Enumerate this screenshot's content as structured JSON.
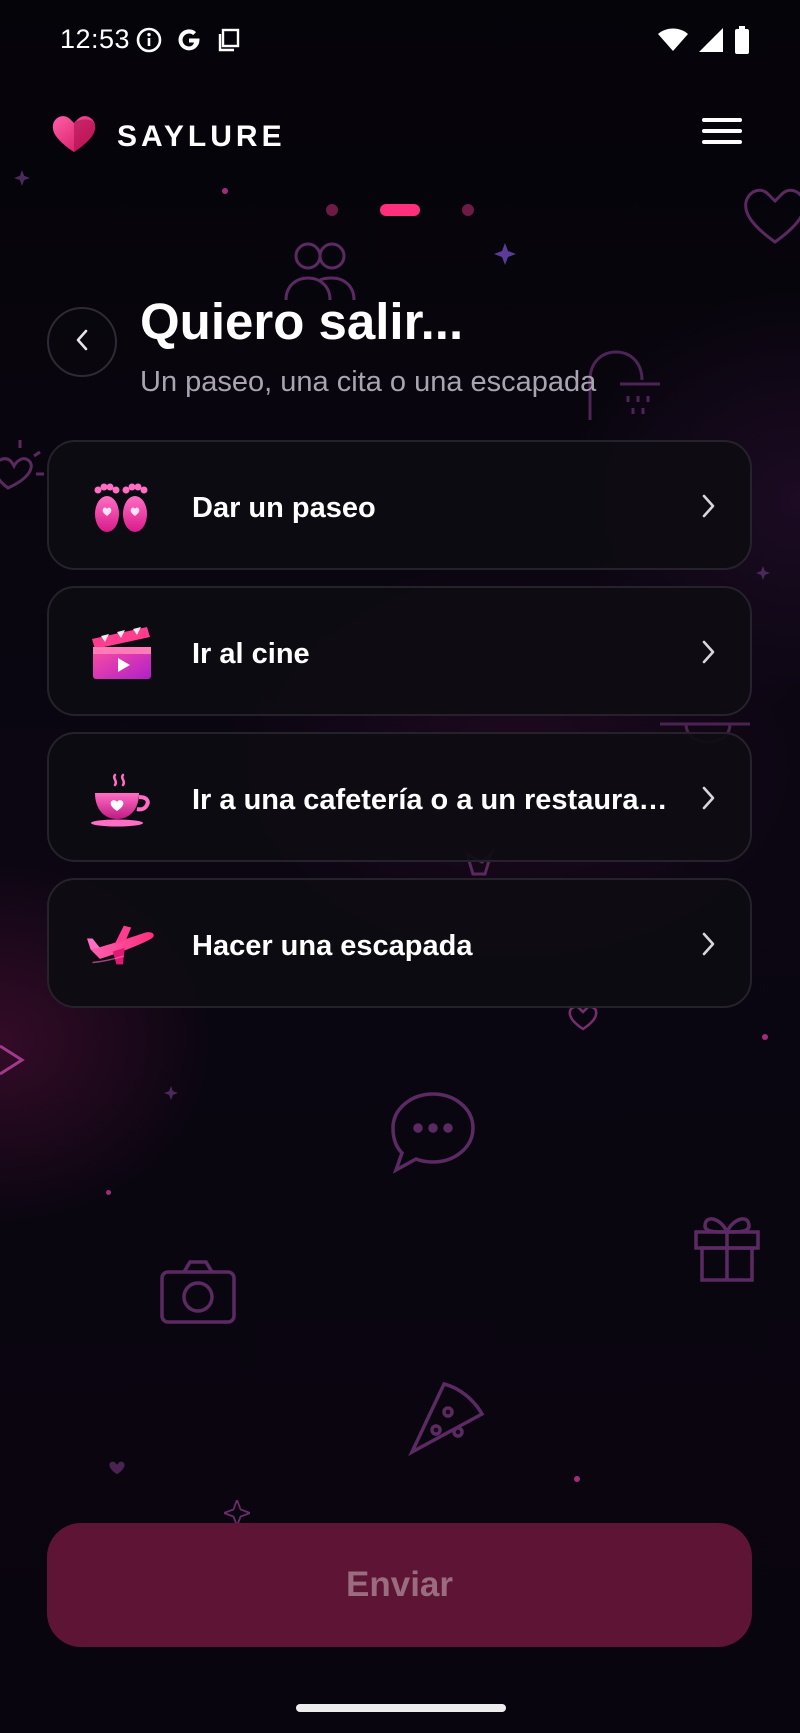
{
  "status_bar": {
    "time": "12:53",
    "left_icons": [
      "info-icon",
      "google-icon",
      "screenshot-icon"
    ],
    "right_icons": [
      "wifi-icon",
      "signal-icon",
      "battery-icon"
    ]
  },
  "header": {
    "brand": "SAYLURE",
    "logo_icon": "heart-logo-icon",
    "menu_icon": "hamburger-menu-icon"
  },
  "pager": {
    "total": 3,
    "active_index": 1
  },
  "title_section": {
    "title": "Quiero salir...",
    "subtitle": "Un paseo, una cita o una escapada"
  },
  "options": [
    {
      "label": "Dar un paseo",
      "icon": "footprints-icon"
    },
    {
      "label": "Ir al cine",
      "icon": "clapperboard-icon"
    },
    {
      "label": "Ir a una cafetería o a un restaurante",
      "icon": "coffee-cup-icon"
    },
    {
      "label": "Hacer una escapada",
      "icon": "airplane-icon"
    }
  ],
  "submit": {
    "label": "Enviar",
    "enabled": false
  },
  "colors": {
    "accent": "#ff2f7d",
    "background": "#07060b",
    "card": "#0e0c12",
    "submit_disabled": "#5e1535"
  }
}
